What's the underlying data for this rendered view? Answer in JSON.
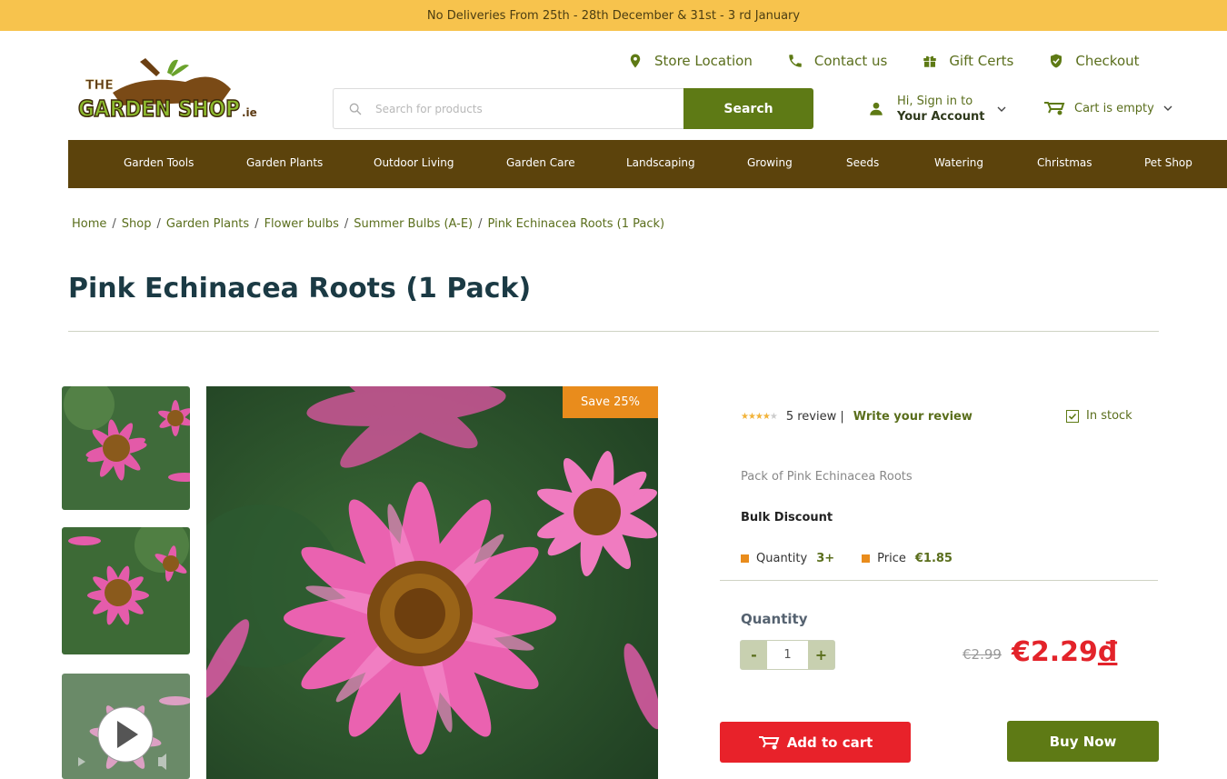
{
  "announcement": "No Deliveries From 25th - 28th December & 31st - 3 rd January",
  "logo": {
    "line1": "THE",
    "line2": "GARDEN SHOP",
    "suffix": ".ie"
  },
  "top_links": [
    {
      "label": "Store Location",
      "icon": "map-pin-icon"
    },
    {
      "label": "Contact us",
      "icon": "phone-icon"
    },
    {
      "label": "Gift Certs",
      "icon": "gift-icon"
    },
    {
      "label": "Checkout",
      "icon": "shield-check-icon"
    }
  ],
  "search": {
    "placeholder": "Search for products",
    "button_label": "Search"
  },
  "account": {
    "line1": "Hi, Sign in to",
    "line2": "Your Account"
  },
  "cart": {
    "label": "Cart is empty"
  },
  "nav": [
    "Garden Tools",
    "Garden Plants",
    "Outdoor Living",
    "Garden Care",
    "Landscaping",
    "Growing",
    "Seeds",
    "Watering",
    "Christmas",
    "Pet Shop"
  ],
  "breadcrumb": [
    "Home",
    "Shop",
    "Garden Plants",
    "Flower bulbs",
    "Summer Bulbs (A-E)",
    "Pink Echinacea Roots (1 Pack)"
  ],
  "product": {
    "title": "Pink Echinacea Roots (1 Pack)",
    "badge": "Save 25%",
    "rating": 4,
    "review_count": "5 review |",
    "write_review": "Write your review",
    "stock": "In stock",
    "description": "Pack of Pink Echinacea Roots",
    "bulk_title": "Bulk Discount",
    "bulk_quantity_label": "Quantity",
    "bulk_quantity_value": "3+",
    "bulk_price_label": "Price",
    "bulk_price_value": "€1.85",
    "quantity_label": "Quantity",
    "quantity_value": "1",
    "minus": "-",
    "plus": "+",
    "old_price": "€2.99",
    "new_price": "€2.29",
    "currency_mark": "đ",
    "add_to_cart": "Add to cart",
    "buy_now": "Buy Now"
  },
  "colors": {
    "accent_green": "#5e7a15",
    "nav_brown": "#5c430c",
    "sale_red": "#e3232a",
    "badge_orange": "#e98c1c",
    "banner_yellow": "#f7c34d"
  }
}
